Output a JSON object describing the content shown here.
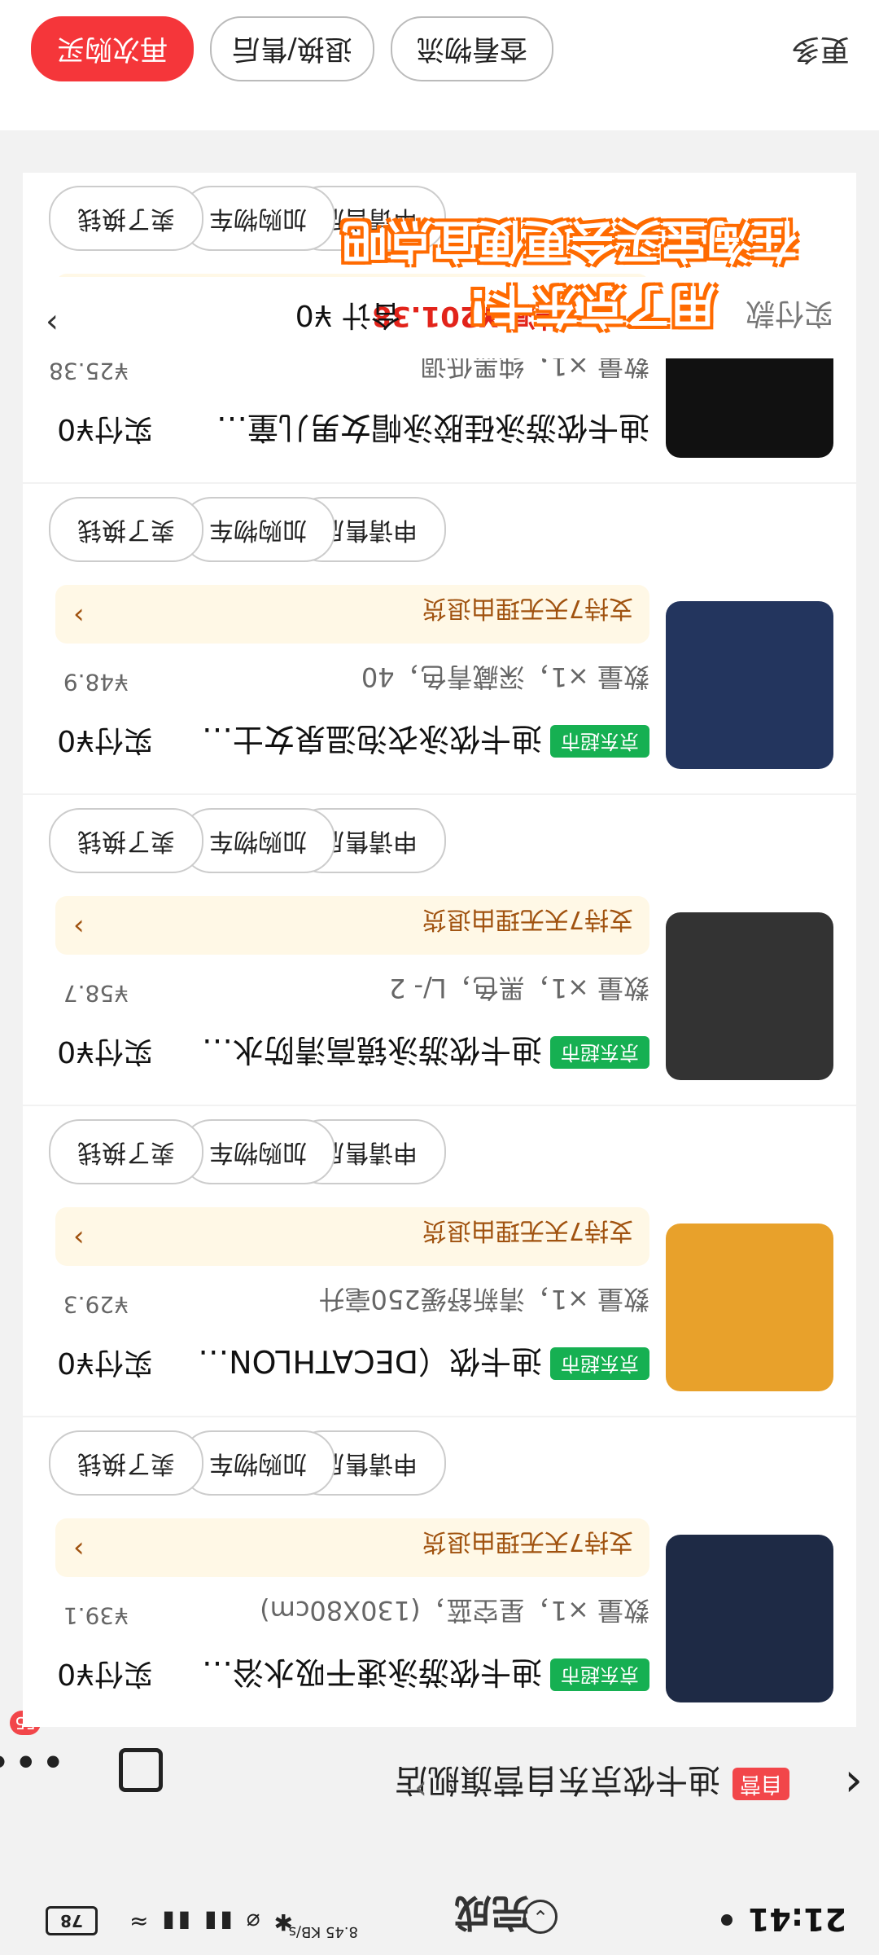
{
  "status_bar": {
    "time": "21:41",
    "network_speed": "8.45 KB/s",
    "battery": "78",
    "title": "完成"
  },
  "store": {
    "badge": "自营",
    "name": "迪卡侬京东自营旗舰店",
    "cart_count": "55"
  },
  "items": [
    {
      "tag": "京东超市",
      "name": "迪卡侬游泳速干吸水浴巾……",
      "pay": "实付¥0",
      "spec": "数量 ×1，星空蓝，(130X80cm)",
      "price": "¥39.1",
      "policy": "支持7天无理由退货",
      "buttons": [
        "申请售后",
        "加购物车",
        "卖了换钱"
      ],
      "thumb_color": "#1e2a45"
    },
    {
      "tag": "京东超市",
      "name": "迪卡侬（DECATHLON）…",
      "pay": "实付¥0",
      "spec": "数量 ×1，清新舒缓250毫升",
      "price": "¥29.3",
      "policy": "支持7天无理由退货",
      "buttons": [
        "申请售后",
        "加购物车",
        "卖了换钱"
      ],
      "thumb_color": "#e8a12b"
    },
    {
      "tag": "京东超市",
      "name": "迪卡侬游泳镜高清防水…",
      "pay": "实付¥0",
      "spec": "数量 ×1，黑色，L/- 2",
      "price": "¥58.7",
      "policy": "支持7天无理由退货",
      "buttons": [
        "申请售后",
        "加购物车",
        "卖了换钱"
      ],
      "thumb_color": "#333333"
    },
    {
      "tag": "京东超市",
      "name": "迪卡侬泳衣泡温泉女士连…",
      "pay": "实付¥0",
      "spec": "数量 ×1，深藏青色，40",
      "price": "¥48.9",
      "policy": "支持7天无理由退货",
      "buttons": [
        "申请售后",
        "加购物车",
        "卖了换钱"
      ],
      "thumb_color": "#23355e"
    },
    {
      "tag": "",
      "name": "迪卡侬游泳硅胶泳帽女男儿童专…",
      "pay": "实付¥0",
      "spec": "数量 ×1，纯黑低调",
      "price": "¥25.38",
      "policy": "支持7天无理由退货",
      "buttons": [
        "申请售后",
        "加购物车",
        "卖了换钱"
      ],
      "thumb_color": "#111111"
    }
  ],
  "summary": {
    "label": "实付款",
    "saved": "共减 ¥201.38",
    "total": "合计 ¥0"
  },
  "actions": {
    "more": "更多",
    "logistics": "查看物流",
    "return": "退换/售后",
    "rebuy": "再次购买"
  },
  "overlay_text": {
    "line1": "用了京东卡!",
    "line2": "在淘宝买会更便宜点吧"
  }
}
